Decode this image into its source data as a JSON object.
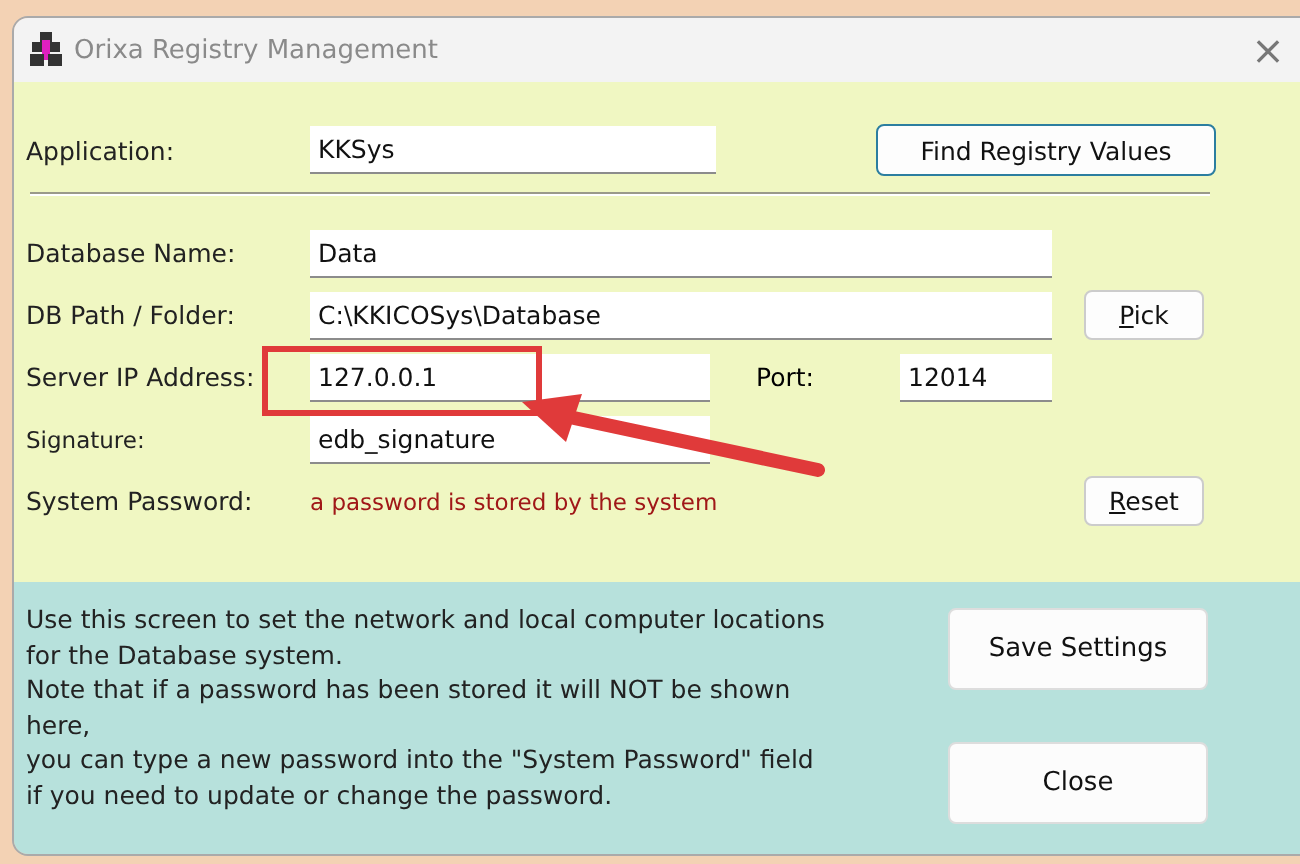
{
  "window": {
    "title": "Orixa Registry Management",
    "close": "×"
  },
  "application": {
    "label": "Application:",
    "value": "KKSys"
  },
  "find_button": "Find Registry Values",
  "fields": [
    {
      "kind": "wide",
      "label": "Database Name:",
      "value": "Data"
    },
    {
      "kind": "wide",
      "label": "DB Path / Folder:",
      "value": "C:\\KKICOSys\\Database",
      "button": "Pick"
    },
    {
      "kind": "port",
      "label": "Server IP Address:",
      "value": "127.0.0.1",
      "port_label": "Port:",
      "port_value": "12014"
    },
    {
      "kind": "small",
      "label": "Signature:",
      "value": "edb_signature"
    },
    {
      "kind": "note",
      "label": "System Password:",
      "value": "a password is stored by the system",
      "button": "Reset"
    }
  ],
  "help_text": "Use this screen to set the network and local computer locations\nfor the Database system.\nNote that if a password has been stored it will NOT be shown\nhere,\nyou can type a new password into the \"System Password\" field\nif you need to update or change the password.",
  "buttons": [
    "Save Settings",
    "Close"
  ]
}
